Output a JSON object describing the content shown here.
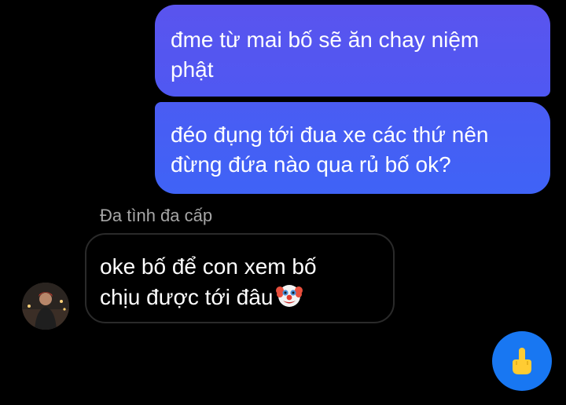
{
  "messages": {
    "outgoing": [
      {
        "text": "đme từ mai bố sẽ ăn chay niệm\nphật"
      },
      {
        "text": "đéo đụng tới đua xe các thứ nên\nđừng đứa nào qua rủ bố ok?"
      }
    ],
    "incoming": {
      "sender_name": "Đa tình đa cấp",
      "text": "oke bố để con xem bố\nchịu được tới đâu",
      "emoji_icon": "clown-face-icon"
    }
  },
  "quick_reaction": {
    "icon": "middle-finger-icon",
    "color": "#1877f2"
  }
}
